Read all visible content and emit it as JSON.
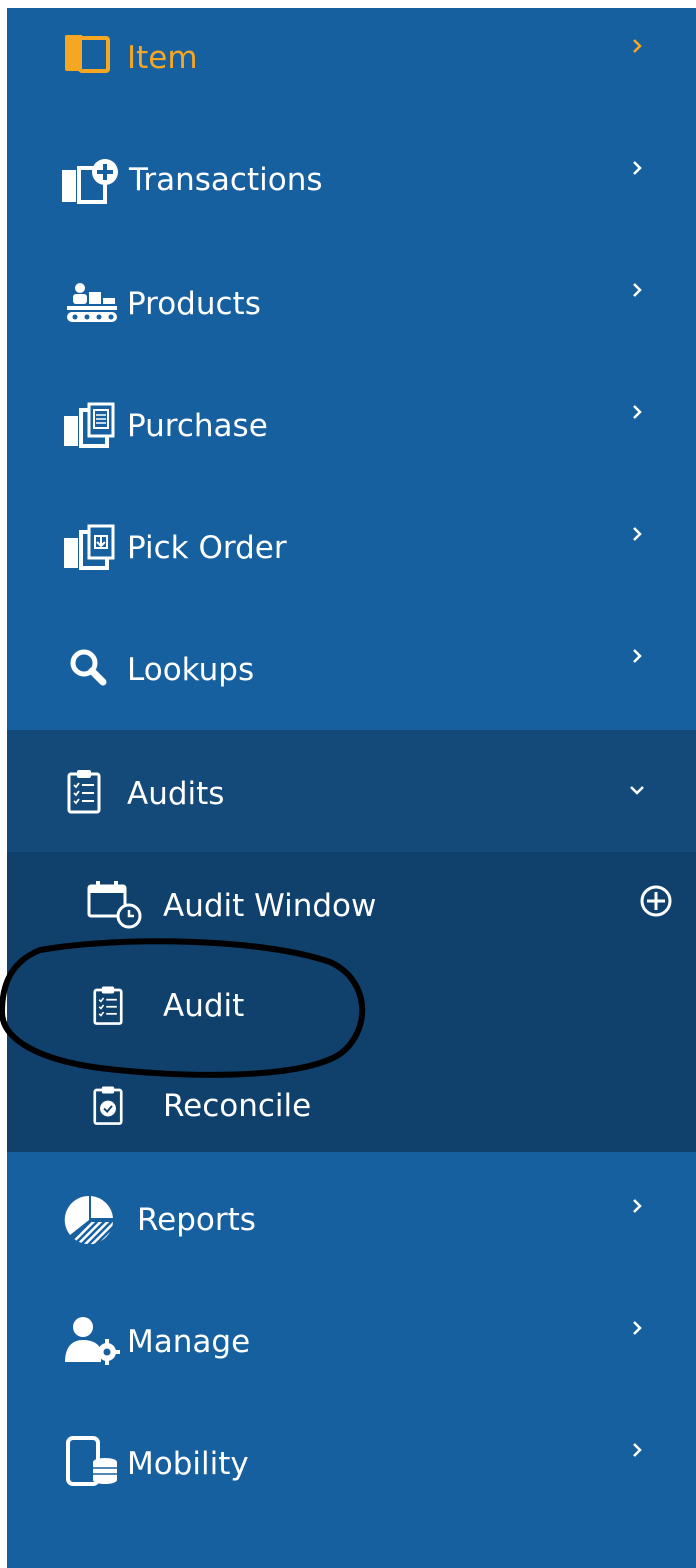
{
  "colors": {
    "sidebar_bg": "#1760a0",
    "expanded_bg": "#134a7a",
    "submenu_bg": "#0f416c",
    "active_text": "#f5a623",
    "text": "#ffffff"
  },
  "menu": {
    "items": [
      {
        "label": "Item",
        "icon": "folder-icon",
        "state": "active"
      },
      {
        "label": "Transactions",
        "icon": "transactions-icon"
      },
      {
        "label": "Products",
        "icon": "products-icon"
      },
      {
        "label": "Purchase",
        "icon": "purchase-icon"
      },
      {
        "label": "Pick Order",
        "icon": "pick-order-icon"
      },
      {
        "label": "Lookups",
        "icon": "search-icon"
      },
      {
        "label": "Audits",
        "icon": "clipboard-checklist-icon",
        "state": "expanded"
      },
      {
        "label": "Reports",
        "icon": "pie-chart-icon"
      },
      {
        "label": "Manage",
        "icon": "user-gear-icon"
      },
      {
        "label": "Mobility",
        "icon": "mobile-database-icon"
      }
    ],
    "audits_submenu": [
      {
        "label": "Audit Window",
        "icon": "calendar-clock-icon",
        "action_icon": "add-circle-icon"
      },
      {
        "label": "Audit",
        "icon": "clipboard-checklist-icon"
      },
      {
        "label": "Reconcile",
        "icon": "clipboard-check-icon"
      }
    ]
  }
}
